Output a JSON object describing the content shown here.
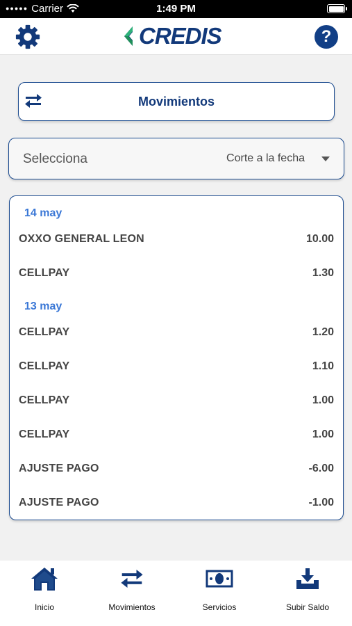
{
  "status_bar": {
    "carrier": "Carrier",
    "time": "1:49 PM"
  },
  "header": {
    "logo_text": "CREDIS",
    "help_label": "?"
  },
  "movimientos_card": {
    "title": "Movimientos"
  },
  "selector": {
    "label": "Selecciona",
    "value": "Corte a la fecha"
  },
  "movements": [
    {
      "date": "14 may",
      "items": [
        {
          "name": "OXXO GENERAL LEON",
          "amount": "10.00"
        },
        {
          "name": "CELLPAY",
          "amount": "1.30"
        }
      ]
    },
    {
      "date": "13 may",
      "items": [
        {
          "name": "CELLPAY",
          "amount": "1.20"
        },
        {
          "name": "CELLPAY",
          "amount": "1.10"
        },
        {
          "name": "CELLPAY",
          "amount": "1.00"
        },
        {
          "name": "CELLPAY",
          "amount": "1.00"
        },
        {
          "name": "AJUSTE PAGO",
          "amount": "-6.00"
        },
        {
          "name": "AJUSTE PAGO",
          "amount": "-1.00"
        }
      ]
    }
  ],
  "tabs": [
    {
      "label": "Inicio",
      "icon": "home-icon"
    },
    {
      "label": "Movimientos",
      "icon": "transfer-arrows-icon"
    },
    {
      "label": "Servicios",
      "icon": "banknote-icon"
    },
    {
      "label": "Subir Saldo",
      "icon": "download-tray-icon"
    }
  ],
  "colors": {
    "brand_navy": "#12397a",
    "date_blue": "#3a77d6",
    "logo_green": "#2fb37a"
  }
}
